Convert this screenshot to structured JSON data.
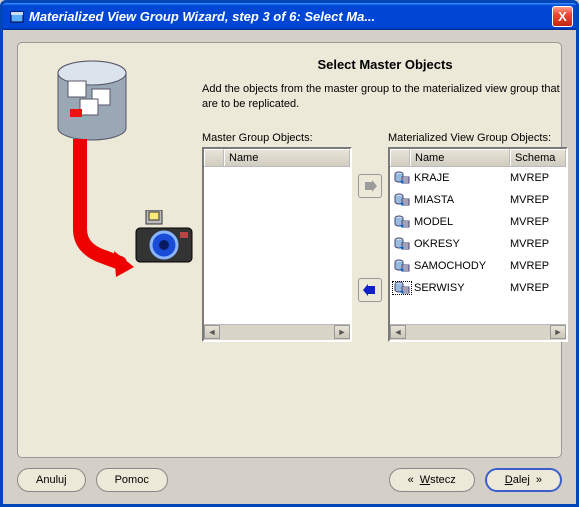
{
  "titlebar": {
    "text": "Materialized View Group Wizard, step 3 of 6: Select Ma...",
    "close": "X"
  },
  "page": {
    "title": "Select Master Objects",
    "desc": "Add the objects from the master group to the materialized view group that are to be replicated."
  },
  "left_list": {
    "label": "Master Group Objects:",
    "col_name": "Name",
    "rows": []
  },
  "right_list": {
    "label": "Materialized View Group Objects:",
    "col_name": "Name",
    "col_schema": "Schema",
    "rows": [
      {
        "name": "KRAJE",
        "schema": "MVREP"
      },
      {
        "name": "MIASTA",
        "schema": "MVREP"
      },
      {
        "name": "MODEL",
        "schema": "MVREP"
      },
      {
        "name": "OKRESY",
        "schema": "MVREP"
      },
      {
        "name": "SAMOCHODY",
        "schema": "MVREP"
      },
      {
        "name": "SERWISY",
        "schema": "MVREP"
      }
    ],
    "selected_index": 5
  },
  "buttons": {
    "cancel": "Anuluj",
    "help": "Pomoc",
    "back_pre": "W",
    "back_rest": "stecz",
    "next_pre": "D",
    "next_rest": "alej"
  },
  "arrows": {
    "left": "«",
    "right": "»",
    "scroll_left": "◄",
    "scroll_right": "►",
    "move_right": "➔",
    "move_left": "←"
  }
}
